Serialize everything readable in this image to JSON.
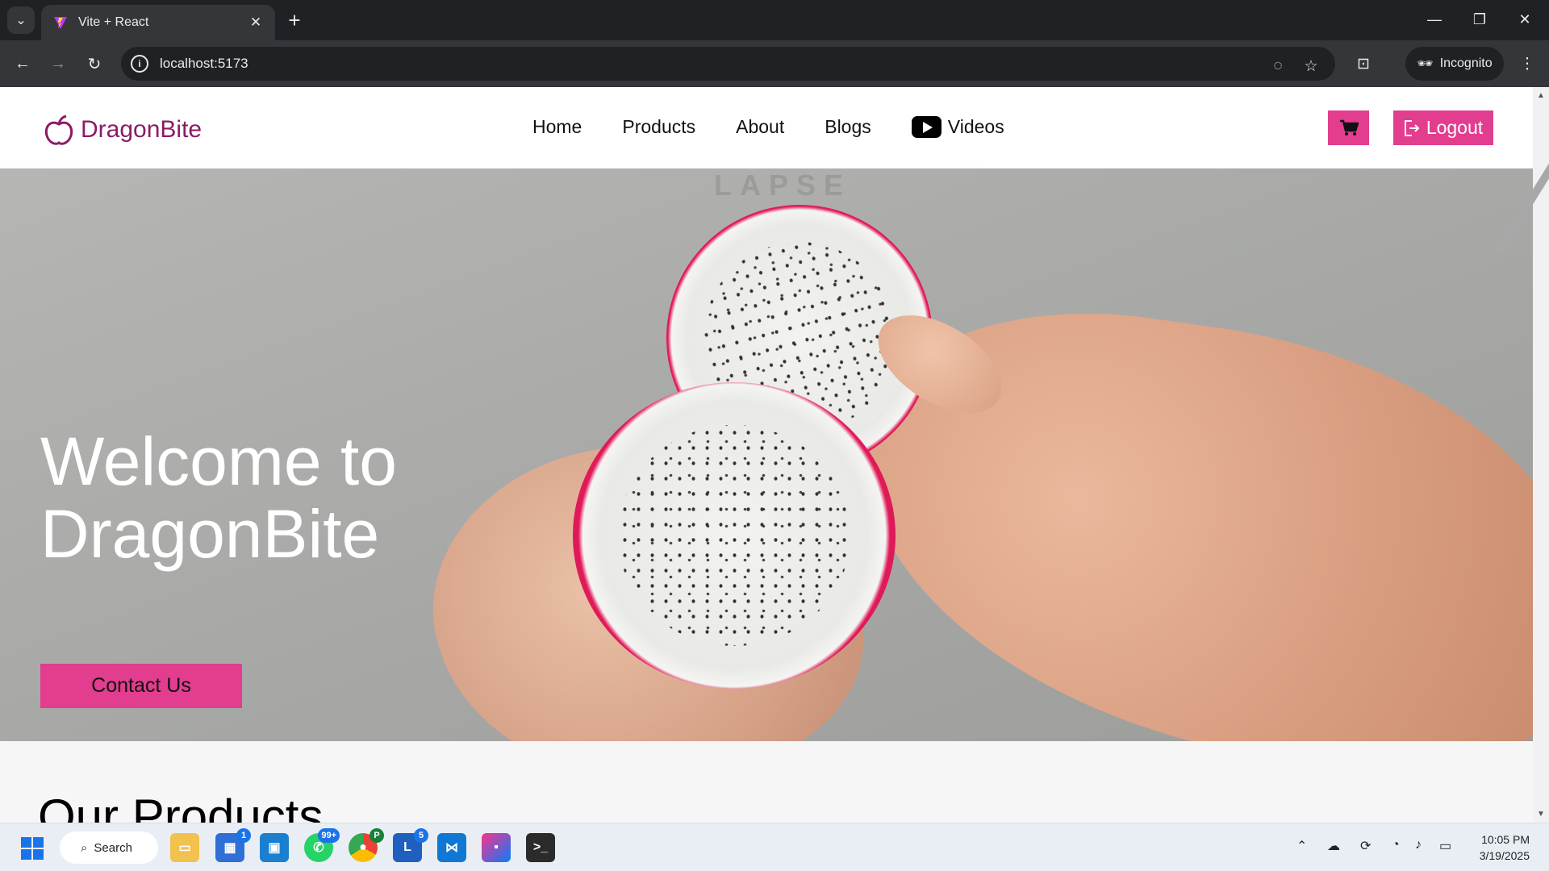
{
  "browser": {
    "tab_title": "Vite + React",
    "new_tab_symbol": "+",
    "url": "localhost:5173",
    "profile_label": "Incognito"
  },
  "site": {
    "brand": "DragonBite",
    "nav": [
      "Home",
      "Products",
      "About",
      "Blogs",
      "Videos"
    ],
    "logout_label": "Logout",
    "hero_title": "Welcome to DragonBite",
    "hero_watermark": "LAPSE",
    "contact_label": "Contact Us",
    "section_title": "Our Products",
    "accent_color": "#e23d8e",
    "brand_color": "#8c1b66"
  },
  "taskbar": {
    "search_label": "Search",
    "badges": {
      "store": "1",
      "whatsapp": "99+",
      "chrome": "P",
      "teams": "5"
    },
    "time": "10:05 PM",
    "date": "3/19/2025"
  }
}
